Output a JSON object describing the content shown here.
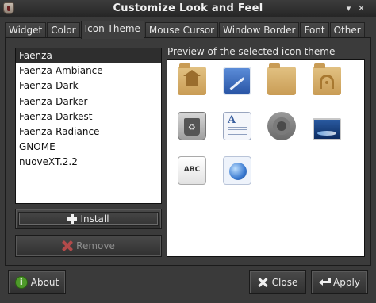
{
  "window": {
    "title": "Customize Look and Feel"
  },
  "tabs": [
    {
      "label": "Widget"
    },
    {
      "label": "Color"
    },
    {
      "label": "Icon Theme",
      "active": true
    },
    {
      "label": "Mouse Cursor"
    },
    {
      "label": "Window Border"
    },
    {
      "label": "Font"
    },
    {
      "label": "Other"
    }
  ],
  "icon_theme_list": {
    "items": [
      "Faenza",
      "Faenza-Ambiance",
      "Faenza-Dark",
      "Faenza-Darker",
      "Faenza-Darkest",
      "Faenza-Radiance",
      "GNOME",
      "nuoveXT.2.2"
    ],
    "selected": "Faenza"
  },
  "buttons": {
    "install": "Install",
    "remove": "Remove",
    "about": "About",
    "close": "Close",
    "apply": "Apply"
  },
  "preview": {
    "label": "Preview of the selected icon theme",
    "icons": [
      "user-home-icon",
      "preferences-desktop-icon",
      "folder-icon",
      "network-wireless-icon",
      "trash-icon",
      "text-document-icon",
      "settings-gear-icon",
      "display-screen-icon",
      "spellcheck-abc-icon",
      "web-browser-globe-icon"
    ],
    "abc_text": "ABC"
  },
  "colors": {
    "window_bg": "#3a3a3a",
    "list_selected_bg": "#2e2e2e",
    "list_bg": "#ffffff",
    "remove_icon": "#b24a4a",
    "about_icon": "#4e9a2a"
  }
}
